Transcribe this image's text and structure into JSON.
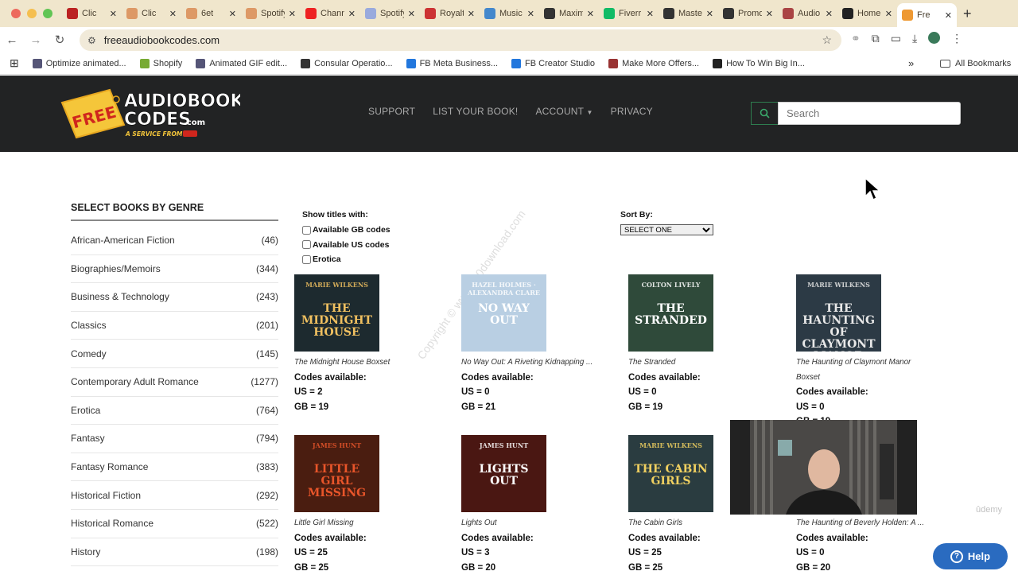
{
  "browser": {
    "tabs": [
      {
        "label": "Clic",
        "color": "#b22"
      },
      {
        "label": "Clic",
        "color": "#d96"
      },
      {
        "label": "6et",
        "color": "#d96"
      },
      {
        "label": "Spotify",
        "color": "#d96"
      },
      {
        "label": "Channe",
        "color": "#e22"
      },
      {
        "label": "Spotify",
        "color": "#9ad"
      },
      {
        "label": "Royalty",
        "color": "#c33"
      },
      {
        "label": "Music F",
        "color": "#48c"
      },
      {
        "label": "Maximi",
        "color": "#333"
      },
      {
        "label": "Fiverr /",
        "color": "#1b6"
      },
      {
        "label": "Master",
        "color": "#333"
      },
      {
        "label": "Promo",
        "color": "#333"
      },
      {
        "label": "Audio F",
        "color": "#a44"
      },
      {
        "label": "Home",
        "color": "#222"
      },
      {
        "label": "Fre",
        "color": "#e93"
      }
    ],
    "url": "freeaudiobookcodes.com",
    "bookmarks": [
      {
        "label": "Optimize animated...",
        "color": "#557"
      },
      {
        "label": "Shopify",
        "color": "#7a3"
      },
      {
        "label": "Animated GIF edit...",
        "color": "#557"
      },
      {
        "label": "Consular Operatio...",
        "color": "#333"
      },
      {
        "label": "FB Meta Business...",
        "color": "#27d"
      },
      {
        "label": "FB Creator Studio",
        "color": "#27d"
      },
      {
        "label": "Make More Offers...",
        "color": "#933"
      },
      {
        "label": "How To Win Big In...",
        "color": "#222"
      }
    ],
    "all_bookmarks": "All Bookmarks"
  },
  "header": {
    "logo_line1": "AUDIOBOOK",
    "logo_line2": "CODES",
    "logo_com": ".com",
    "logo_free": "FREE",
    "logo_tag": "A SERVICE FROM",
    "nav": [
      "SUPPORT",
      "LIST YOUR BOOK!",
      "ACCOUNT",
      "PRIVACY"
    ],
    "search_placeholder": "Search"
  },
  "sidebar": {
    "title": "SELECT BOOKS BY GENRE",
    "genres": [
      {
        "name": "African-American Fiction",
        "count": "(46)"
      },
      {
        "name": "Biographies/Memoirs",
        "count": "(344)"
      },
      {
        "name": "Business & Technology",
        "count": "(243)"
      },
      {
        "name": "Classics",
        "count": "(201)"
      },
      {
        "name": "Comedy",
        "count": "(145)"
      },
      {
        "name": "Contemporary Adult Romance",
        "count": "(1277)"
      },
      {
        "name": "Erotica",
        "count": "(764)"
      },
      {
        "name": "Fantasy",
        "count": "(794)"
      },
      {
        "name": "Fantasy Romance",
        "count": "(383)"
      },
      {
        "name": "Historical Fiction",
        "count": "(292)"
      },
      {
        "name": "Historical Romance",
        "count": "(522)"
      },
      {
        "name": "History",
        "count": "(198)"
      }
    ]
  },
  "filters": {
    "label": "Show titles with:",
    "options": [
      "Available GB codes",
      "Available US codes",
      "Erotica"
    ]
  },
  "sort": {
    "label": "Sort By:",
    "selected": "SELECT ONE"
  },
  "codes_label": "Codes available:",
  "books": [
    {
      "title": "The Midnight House Boxset",
      "us": "US = 2",
      "gb": "GB = 19",
      "cover_text": "THE MIDNIGHT HOUSE",
      "cover_author": "MARIE WILKENS",
      "bg": "#1d2a2f",
      "fg": "#f0c060"
    },
    {
      "title": "No Way Out: A Riveting Kidnapping ...",
      "us": "US = 0",
      "gb": "GB = 21",
      "cover_text": "NO WAY OUT",
      "cover_author": "HAZEL HOLMES · ALEXANDRA CLARE",
      "bg": "#b9cfe3",
      "fg": "#ffffff"
    },
    {
      "title": "The Stranded",
      "us": "US = 0",
      "gb": "GB = 19",
      "cover_text": "THE STRANDED",
      "cover_author": "COLTON LIVELY",
      "bg": "#2f4a3a",
      "fg": "#ffffff"
    },
    {
      "title": "The Haunting of Claymont Manor",
      "title2": "Boxset",
      "us": "US = 0",
      "gb": "GB = 19",
      "cover_text": "THE HAUNTING OF CLAYMONT MANOR",
      "cover_author": "MARIE WILKENS",
      "bg": "#2c3a45",
      "fg": "#e8e8e8"
    },
    {
      "title": "Little Girl Missing",
      "us": "US = 25",
      "gb": "GB = 25",
      "cover_text": "LITTLE GIRL MISSING",
      "cover_author": "JAMES HUNT",
      "bg": "#4a1d10",
      "fg": "#e8552a"
    },
    {
      "title": "Lights Out",
      "us": "US = 3",
      "gb": "GB = 20",
      "cover_text": "LIGHTS OUT",
      "cover_author": "JAMES HUNT",
      "bg": "#4a1712",
      "fg": "#ffffff"
    },
    {
      "title": "The Cabin Girls",
      "us": "US = 25",
      "gb": "GB = 25",
      "cover_text": "THE CABIN GIRLS",
      "cover_author": "MARIE WILKENS",
      "bg": "#2a3c40",
      "fg": "#f0d060"
    },
    {
      "title": "The Haunting of Beverly Holden: A ...",
      "us": "US = 0",
      "gb": "GB = 20",
      "cover_text": "",
      "cover_author": "",
      "bg": "#ffffff",
      "fg": "#333"
    }
  ],
  "help_label": "Help",
  "watermark": "Copyright © www.p30download.com",
  "udemy_mark": "ûdemy"
}
